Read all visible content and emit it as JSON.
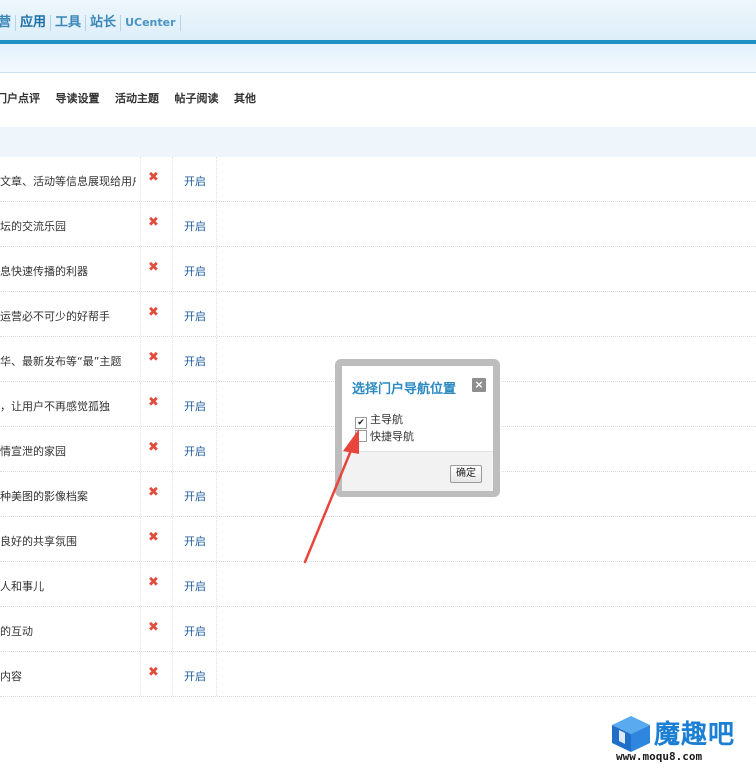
{
  "topnav": {
    "items": [
      {
        "label": "营"
      },
      {
        "label": "应用"
      },
      {
        "label": "工具"
      },
      {
        "label": "站长"
      },
      {
        "label": "UCenter"
      }
    ]
  },
  "tabs": [
    "门户点评",
    "导读设置",
    "活动主题",
    "帖子阅读",
    "其他"
  ],
  "rows": [
    {
      "desc": "文章、活动等信息展现给用户",
      "status_icon": "✖",
      "action": "开启"
    },
    {
      "desc": "坛的交流乐园",
      "status_icon": "✖",
      "action": "开启"
    },
    {
      "desc": "息快速传播的利器",
      "status_icon": "✖",
      "action": "开启"
    },
    {
      "desc": "运营必不可少的好帮手",
      "status_icon": "✖",
      "action": "开启"
    },
    {
      "desc": "华、最新发布等“最”主题",
      "status_icon": "✖",
      "action": "开启"
    },
    {
      "desc": "，让用户不再感觉孤独",
      "status_icon": "✖",
      "action": "开启"
    },
    {
      "desc": "情宣泄的家园",
      "status_icon": "✖",
      "action": "开启"
    },
    {
      "desc": "种美图的影像档案",
      "status_icon": "✖",
      "action": "开启"
    },
    {
      "desc": "良好的共享氛围",
      "status_icon": "✖",
      "action": "开启"
    },
    {
      "desc": "人和事儿",
      "status_icon": "✖",
      "action": "开启"
    },
    {
      "desc": "的互动",
      "status_icon": "✖",
      "action": "开启"
    },
    {
      "desc": "内容",
      "status_icon": "✖",
      "action": "开启"
    }
  ],
  "dialog": {
    "title": "选择门户导航位置",
    "close_icon": "×",
    "options": [
      {
        "label": "主导航",
        "checked": true,
        "mark": "✔"
      },
      {
        "label": "快捷导航",
        "checked": false,
        "mark": ""
      }
    ],
    "ok_label": "确定"
  },
  "watermark": {
    "name": "魔趣吧",
    "url": "www.moqu8.com"
  },
  "colors": {
    "accent": "#1e90c2",
    "dialog_title": "#2b8ac2",
    "status_off": "#e24c3c",
    "link": "#1f5c9e",
    "arrow": "#e8453c"
  }
}
